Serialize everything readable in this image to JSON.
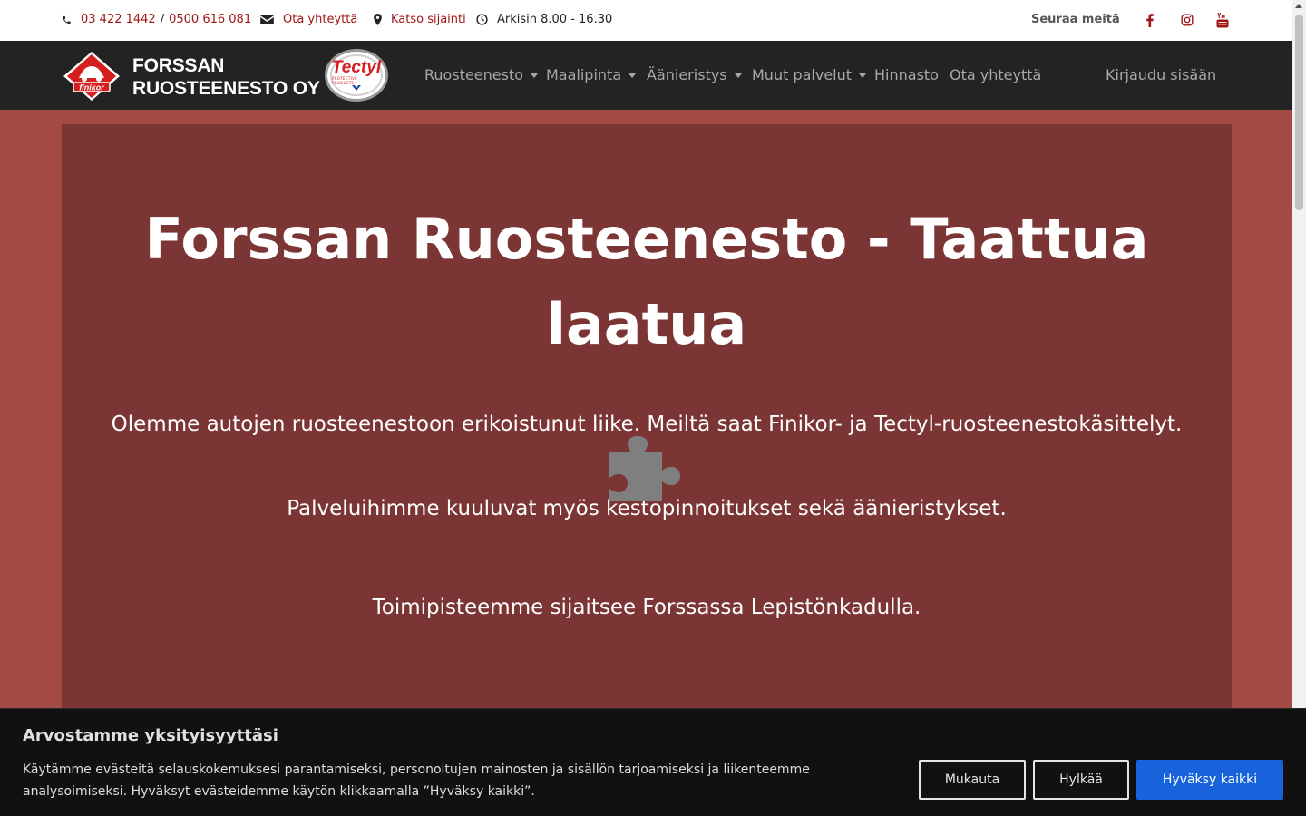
{
  "topbar": {
    "phone1": "03 422 1442",
    "phone_sep": "/",
    "phone2": "0500 616 081",
    "contact": "Ota yhteyttä",
    "location": "Katso sijainti",
    "hours": "Arkisin 8.00 - 16.30",
    "follow": "Seuraa meitä",
    "social_icons": [
      "facebook-icon",
      "instagram-icon",
      "youtube-icon"
    ]
  },
  "nav": {
    "logo_line1": "FORSSAN",
    "logo_line2": "RUOSTEENESTO OY",
    "finikor_label": "finikor",
    "tectyl_label": "Tectyl",
    "tectyl_sub": "PROTECTIVE PRODUCTS",
    "items": [
      {
        "label": "Ruosteenesto",
        "dropdown": true
      },
      {
        "label": "Maalipinta",
        "dropdown": true
      },
      {
        "label": "Äänieristys",
        "dropdown": true
      },
      {
        "label": "Muut palvelut",
        "dropdown": true
      },
      {
        "label": "Hinnasto",
        "dropdown": false
      },
      {
        "label": "Ota yhteyttä",
        "dropdown": false
      }
    ],
    "login": "Kirjaudu sisään"
  },
  "hero": {
    "title_line1": "Forssan Ruosteenesto - Taattua",
    "title_line2": "laatua",
    "para1": "Olemme autojen ruosteenestoon erikoistunut liike. Meiltä saat Finikor- ja Tectyl-ruosteenestokäsittelyt.",
    "para2": "Palveluihimme kuuluvat myös kestopinnoitukset sekä äänieristykset.",
    "para3": "Toimipisteemme sijaitsee Forssassa Lepistönkadulla."
  },
  "cookie": {
    "title": "Arvostamme yksityisyyttäsi",
    "text_line1": "Käytämme evästeitä selauskokemuksesi parantamiseksi, personoitujen mainosten ja sisällön tarjoamiseksi ja liikenteemme",
    "text_line2": "analysoimiseksi. Hyväksyt evästeidemme käytön klikkaamalla ”Hyväksy kaikki”.",
    "customize": "Mukauta",
    "reject": "Hylkää",
    "accept": "Hyväksy kaikki"
  },
  "colors": {
    "accent": "#a01515",
    "page_bg": "#a34a45",
    "hero_bg": "#7b3535",
    "nav_bg": "#232323",
    "primary_button": "#1863dc"
  }
}
